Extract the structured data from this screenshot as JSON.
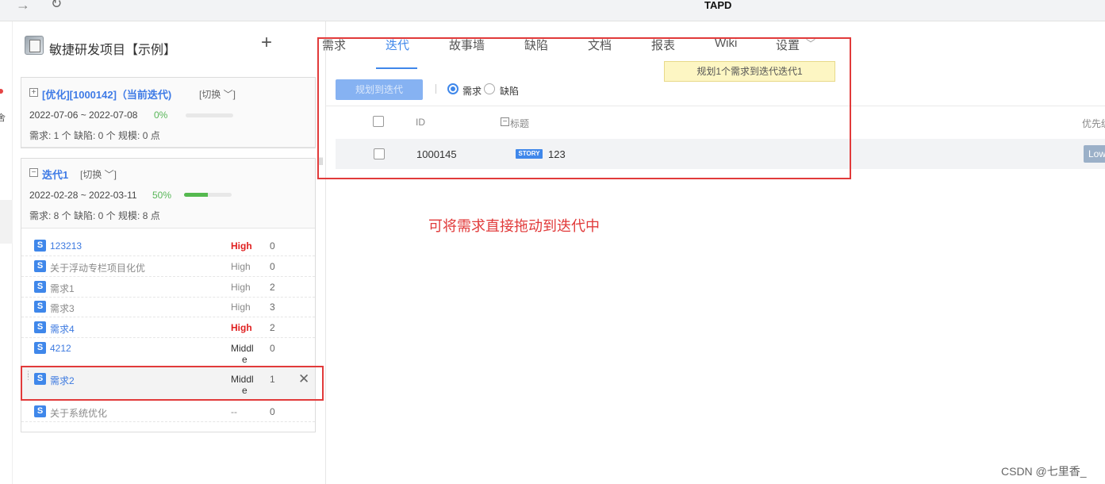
{
  "topbar": {
    "title": "TAPD",
    "forward_icon": "→",
    "reload_icon": "↻"
  },
  "leftstrip": {
    "cut_char": "舍"
  },
  "project": {
    "name": "敏捷研发项目【示例】",
    "add_icon": "+"
  },
  "iterations": [
    {
      "toggle": "+",
      "title": "[优化][1000142]（当前迭代)",
      "switch_label": "[切换 ﹀]",
      "dates": "2022-07-06 ~ 2022-07-08",
      "progress_text": "0%",
      "progress": 0,
      "stats": "需求: 1 个    缺陷: 0 个    规模: 0 点"
    },
    {
      "toggle": "−",
      "title": "迭代1",
      "switch_label": "[切换 ﹀]",
      "dates": "2022-02-28 ~ 2022-03-11",
      "progress_text": "50%",
      "progress": 0.5,
      "stats": "需求: 8 个    缺陷: 0 个    规模: 8 点"
    }
  ],
  "stories": [
    {
      "badge": "S",
      "name": "123213",
      "priority": "High",
      "size": "0"
    },
    {
      "badge": "S",
      "name": "关于浮动专栏项目化优",
      "priority": "High",
      "size": "0"
    },
    {
      "badge": "S",
      "name": "需求1",
      "priority": "High",
      "size": "2"
    },
    {
      "badge": "S",
      "name": "需求3",
      "priority": "High",
      "size": "3"
    },
    {
      "badge": "S",
      "name": "需求4",
      "priority": "High",
      "size": "2"
    },
    {
      "badge": "S",
      "name": "4212",
      "priority_l1": "Middl",
      "priority_l2": "e",
      "size": "0"
    },
    {
      "badge": "S",
      "name": "需求2",
      "priority_l1": "Middl",
      "priority_l2": "e",
      "size": "1",
      "close": "✕"
    },
    {
      "badge": "S",
      "name": "关于系统优化",
      "priority": "--",
      "size": "0"
    }
  ],
  "tabs": [
    "需求",
    "迭代",
    "故事墙",
    "缺陷",
    "文档",
    "报表",
    "Wiki",
    "设置"
  ],
  "tab_chevron": "﹀",
  "tooltip": "规划1个需求到迭代迭代1",
  "toolbar": {
    "plan_button": "规划到迭代",
    "radio_story": "需求",
    "radio_bug": "缺陷"
  },
  "table": {
    "headers": {
      "id": "ID",
      "title": "标题",
      "title_toggle": "−",
      "priority": "优先级"
    },
    "rows": [
      {
        "id": "1000145",
        "tag": "STORY",
        "title": "123",
        "priority": "Low"
      }
    ]
  },
  "annotation": "可将需求直接拖动到迭代中",
  "watermark": "CSDN @七里香_"
}
